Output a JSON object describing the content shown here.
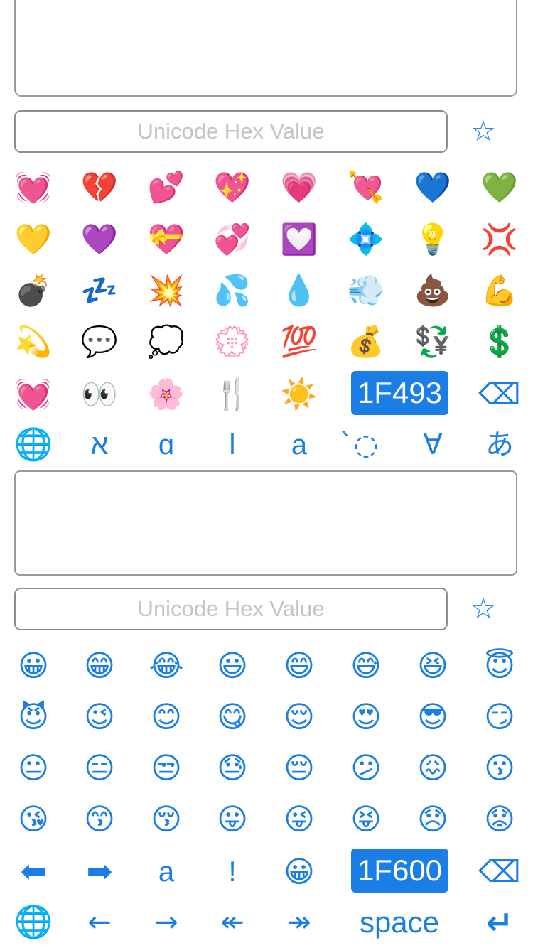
{
  "top": {
    "hex_placeholder": "Unicode Hex Value",
    "star": "☆",
    "emoji_rows": [
      [
        "💓",
        "💔",
        "💕",
        "💖",
        "💗",
        "💘",
        "💙",
        "💚"
      ],
      [
        "💛",
        "💜",
        "💝",
        "💞",
        "💟",
        "💠",
        "💡",
        "💢"
      ],
      [
        "💣",
        "💤",
        "💥",
        "💦",
        "💧",
        "💨",
        "💩",
        "💪"
      ],
      [
        "💫",
        "💬",
        "💭",
        "💮",
        "💯",
        "💰",
        "💱",
        "💲"
      ]
    ],
    "last_row": [
      "💓",
      "👀",
      "🌸",
      "🍴",
      "☀️"
    ],
    "hex_value": "1F493",
    "backspace": "⌫",
    "keyboard_row": [
      "🌐",
      "א",
      "ɑ",
      "ǀ",
      "a",
      "̀◌",
      "∀",
      "あ"
    ]
  },
  "bottom": {
    "hex_placeholder": "Unicode Hex Value",
    "star": "☆",
    "emoji_rows": [
      [
        "😀",
        "😁",
        "😂",
        "😃",
        "😄",
        "😅",
        "😆",
        "😇"
      ],
      [
        "😈",
        "😉",
        "😊",
        "😋",
        "😌",
        "😍",
        "😎",
        "😏"
      ],
      [
        "😐",
        "😑",
        "😒",
        "😓",
        "😔",
        "😕",
        "😖",
        "😗"
      ],
      [
        "😘",
        "😙",
        "😚",
        "😛",
        "😜",
        "😝",
        "😞",
        "😟"
      ]
    ],
    "nav_row": [
      "⬅",
      "➡",
      "a",
      "!",
      "😀"
    ],
    "hex_value": "1F600",
    "backspace": "⌫",
    "keyboard_row": [
      "🌐",
      "←",
      "→",
      "↞",
      "↠"
    ],
    "space_label": "space",
    "return_key": "↵"
  }
}
